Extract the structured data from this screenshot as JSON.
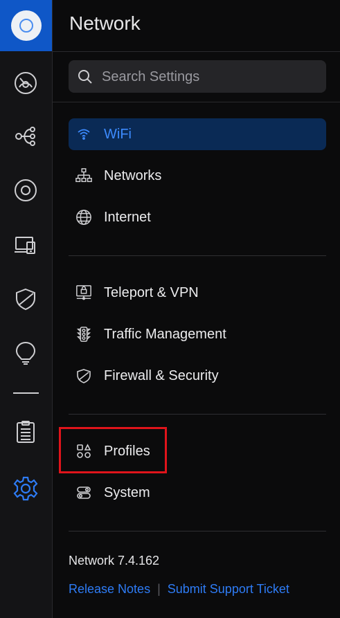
{
  "app": {
    "title": "Network"
  },
  "search": {
    "placeholder": "Search Settings"
  },
  "rail": {
    "icons": [
      "dashboard-icon",
      "topology-icon",
      "devices-icon",
      "clients-icon",
      "security-icon",
      "insights-icon",
      "logs-icon",
      "settings-icon"
    ],
    "active": "settings-icon"
  },
  "nav": {
    "group1": [
      {
        "label": "WiFi",
        "icon": "wifi-icon",
        "active": true
      },
      {
        "label": "Networks",
        "icon": "networks-icon"
      },
      {
        "label": "Internet",
        "icon": "globe-icon"
      }
    ],
    "group2": [
      {
        "label": "Teleport & VPN",
        "icon": "vpn-icon"
      },
      {
        "label": "Traffic Management",
        "icon": "traffic-light-icon"
      },
      {
        "label": "Firewall & Security",
        "icon": "shield-icon"
      }
    ],
    "group3": [
      {
        "label": "Profiles",
        "icon": "profiles-icon",
        "highlighted": true
      },
      {
        "label": "System",
        "icon": "system-icon"
      }
    ]
  },
  "footer": {
    "version": "Network 7.4.162",
    "release_notes": "Release Notes",
    "separator": "|",
    "support": "Submit Support Ticket"
  },
  "colors": {
    "accent": "#2e7cf6",
    "active_bg": "#0a2a55",
    "highlight": "#e0141b",
    "brand": "#0f57c7"
  }
}
